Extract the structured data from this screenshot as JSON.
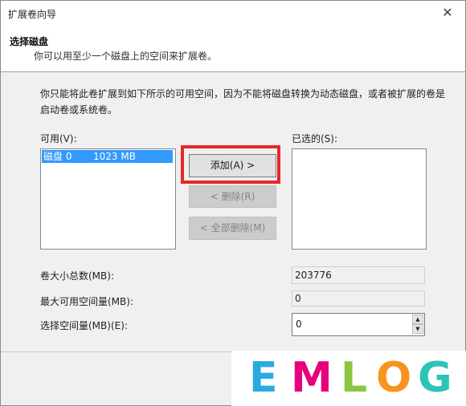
{
  "window": {
    "title": "扩展卷向导",
    "close_glyph": "✕"
  },
  "header": {
    "title": "选择磁盘",
    "subtitle": "你可以用至少一个磁盘上的空间来扩展卷。"
  },
  "description": "你只能将此卷扩展到如下所示的可用空间，因为不能将磁盘转换为动态磁盘，或者被扩展的卷是启动卷或系统卷。",
  "available": {
    "label": "可用(V):",
    "items": [
      {
        "disk": "磁盘 0",
        "size": "1023 MB",
        "selected": true
      }
    ]
  },
  "selected": {
    "label": "已选的(S):",
    "items": []
  },
  "buttons": {
    "add": "添加(A) >",
    "remove": "< 删除(R)",
    "remove_all": "< 全部删除(M)"
  },
  "fields": {
    "total_label": "卷大小总数(MB):",
    "total_value": "203776",
    "max_label": "最大可用空间量(MB):",
    "max_value": "0",
    "select_label": "选择空间量(MB)(E):",
    "select_value": "0"
  },
  "watermark": {
    "letters": [
      "E",
      "M",
      "L",
      "O",
      "G"
    ],
    "colors": [
      "#29abe2",
      "#e6007e",
      "#8cc63f",
      "#f7931e",
      "#2bc4b6"
    ]
  },
  "colors": {
    "selection": "#3399ff",
    "highlight_box": "#e8282c"
  }
}
